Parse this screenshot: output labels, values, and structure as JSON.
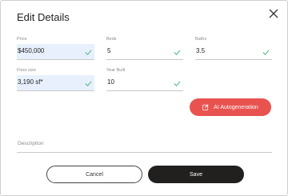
{
  "dialog": {
    "title": "Edit Details"
  },
  "fields": {
    "price": {
      "label": "Price",
      "value": "$450,000"
    },
    "beds": {
      "label": "Beds",
      "value": "5"
    },
    "baths": {
      "label": "Baths",
      "value": "3.5"
    },
    "floor_size": {
      "label": "Floor size",
      "value": "3,190 sf*"
    },
    "year_built": {
      "label": "Year Built",
      "value": "10"
    },
    "description": {
      "label": "Description",
      "value": ""
    }
  },
  "buttons": {
    "ai": "AI Autogeneration",
    "cancel": "Cancel",
    "save": "Save"
  },
  "colors": {
    "accent": "#e8534f",
    "check": "#3cb371",
    "filled_bg": "#e8f0fe",
    "save_bg": "#221f1f"
  }
}
